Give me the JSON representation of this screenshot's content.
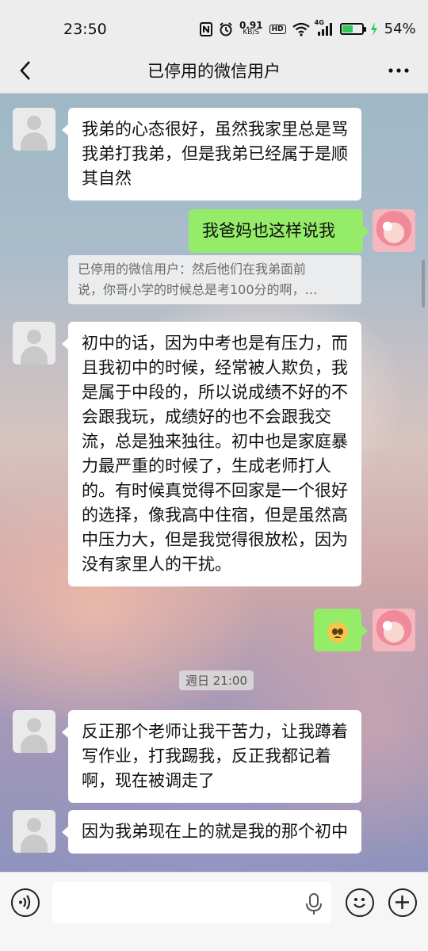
{
  "status_bar": {
    "time": "23:50",
    "net_speed_value": "0.91",
    "net_speed_unit": "KB/S",
    "hd_label": "HD",
    "signal_label": "4G",
    "battery_percent": "54%",
    "battery_level": 0.54,
    "icons": [
      "nfc-icon",
      "alarm-icon",
      "wifi-icon",
      "signal-icon",
      "battery-icon",
      "charging-icon"
    ]
  },
  "nav": {
    "title": "已停用的微信用户",
    "back_icon": "chevron-left-icon",
    "more_icon": "more-dots-icon"
  },
  "messages": [
    {
      "side": "left",
      "text": "我弟的心态很好，虽然我家里总是骂我弟打我弟，但是我弟已经属于是顺其自然"
    },
    {
      "side": "right",
      "text": "我爸妈也这样说我"
    },
    {
      "quote_line1": "已停用的微信用户：然后他们在我弟面前",
      "quote_line2": "说，你哥小学的时候总是考100分的啊，…"
    },
    {
      "side": "left",
      "text": "初中的话，因为中考也是有压力，而且我初中的时候，经常被人欺负，我是属于中段的，所以说成绩不好的不会跟我玩，成绩好的也不会跟我交流，总是独来独往。初中也是家庭暴力最严重的时候了，生成老师打人的。有时候真觉得不回家是一个很好的选择，像我高中住宿，但是虽然高中压力大，但是我觉得很放松，因为没有家里人的干扰。"
    },
    {
      "side": "right",
      "emoji": "pleading-face-icon"
    },
    {
      "side": "left",
      "text": "反正那个老师让我干苦力，让我蹲着写作业，打我踢我，反正我都记着啊，现在被调走了"
    },
    {
      "side": "left",
      "text": "因为我弟现在上的就是我的那个初中"
    }
  ],
  "time_separator": "週日 21:00",
  "input_bar": {
    "value": "",
    "voice_icon": "voice-icon",
    "mic_icon": "mic-icon",
    "emoji_icon": "emoji-icon",
    "plus_icon": "plus-icon"
  }
}
